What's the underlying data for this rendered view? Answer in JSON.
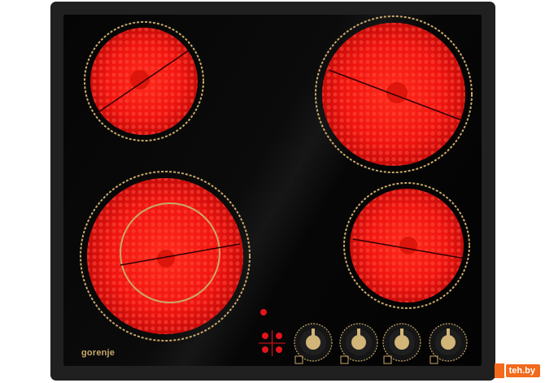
{
  "product": {
    "brand_label": "gorenje",
    "cooktop_type": "ceramic glass, 4 radiant zones",
    "colors": {
      "glass": "#050505",
      "frame": "#202020",
      "heating_element": "#ff1a14",
      "zone_ring": "#c8a86a",
      "indicator_red": "#e3151b"
    }
  },
  "zones": [
    {
      "name": "rear-left",
      "rings": 1
    },
    {
      "name": "rear-right",
      "rings": 1
    },
    {
      "name": "front-left",
      "rings": 2
    },
    {
      "name": "front-right",
      "rings": 1
    }
  ],
  "controls": {
    "knob_count": 4,
    "zone_indicator_icon": "four-dot-zone-indicator",
    "knob_icon": "rotary-knob"
  },
  "watermark": {
    "text": "teh.by"
  }
}
